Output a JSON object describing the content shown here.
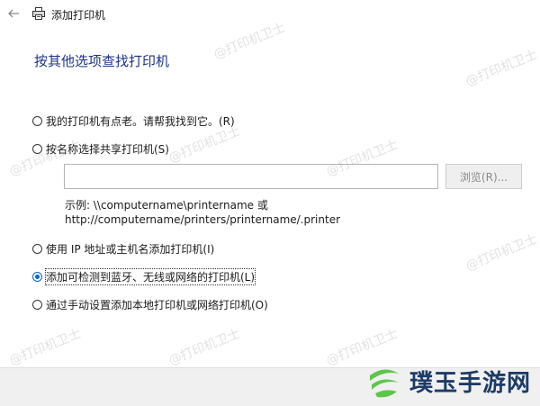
{
  "window": {
    "back_icon": "back-arrow-icon",
    "title_icon": "printer-icon",
    "title": "添加打印机"
  },
  "heading": "按其他选项查找打印机",
  "options": [
    {
      "label": "我的打印机有点老。请帮我找到它。(R)",
      "selected": false
    },
    {
      "label": "按名称选择共享打印机(S)",
      "selected": false
    },
    {
      "label": "使用 IP 地址或主机名添加打印机(I)",
      "selected": false
    },
    {
      "label": "添加可检测到蓝牙、无线或网络的打印机(L)",
      "selected": true
    },
    {
      "label": "通过手动设置添加本地打印机或网络打印机(O)",
      "selected": false
    }
  ],
  "share_input": {
    "value": ""
  },
  "browse_label": "浏览(R)...",
  "example": {
    "line1": "示例: \\\\computername\\printername 或",
    "line2": "http://computername/printers/printername/.printer"
  },
  "watermark": "@打印机卫士",
  "logo": {
    "text": "璞玉手游网",
    "colors": {
      "green": "#5cc64a",
      "navy": "#1d3b66"
    }
  },
  "colors": {
    "heading": "#1e3287",
    "radio_selected": "#0a64c8",
    "footer": "#f0f0f0"
  }
}
